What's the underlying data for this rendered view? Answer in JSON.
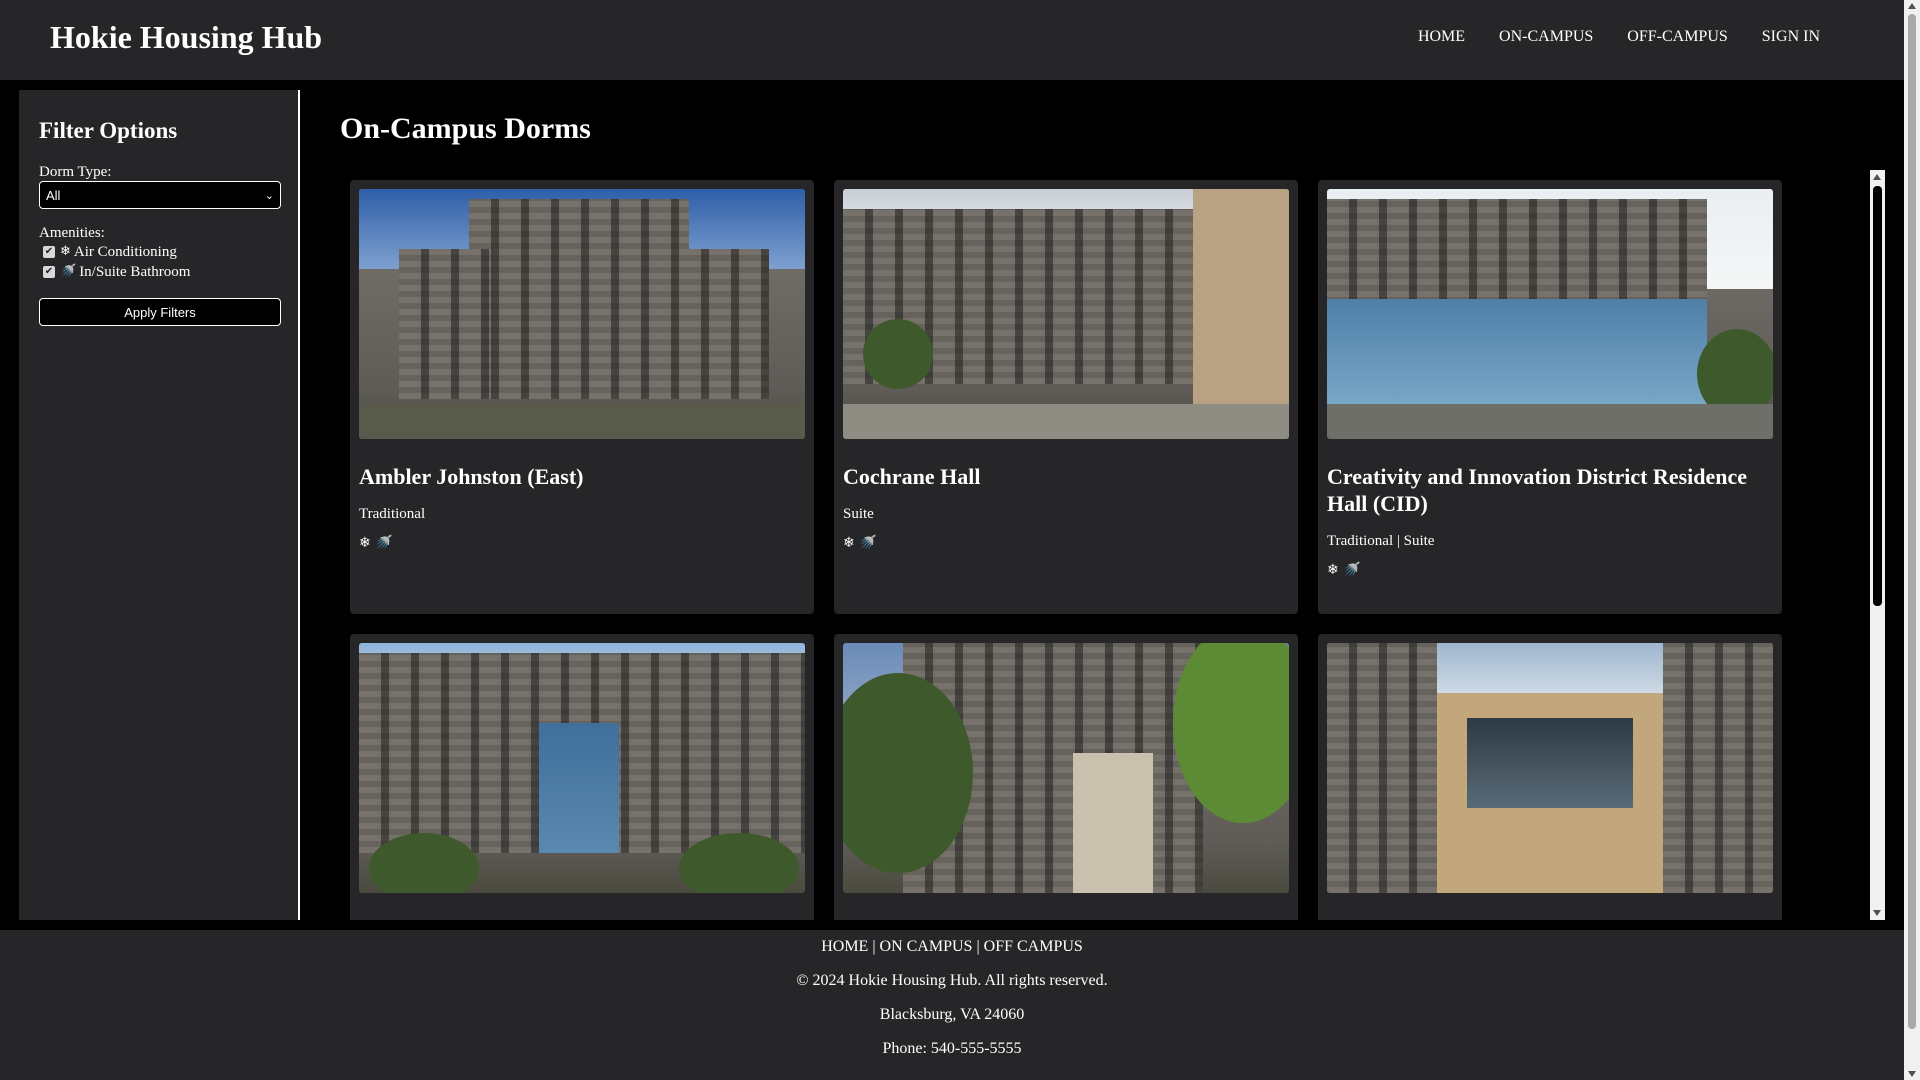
{
  "header": {
    "brand": "Hokie Housing Hub",
    "nav": [
      "HOME",
      "ON-CAMPUS",
      "OFF-CAMPUS",
      "SIGN IN"
    ]
  },
  "sidebar": {
    "title": "Filter Options",
    "dorm_type_label": "Dorm Type:",
    "dorm_type_value": "All",
    "amenities_label": "Amenities:",
    "amenities": [
      {
        "icon": "❄",
        "label": "Air Conditioning",
        "checked": true
      },
      {
        "icon": "🚿",
        "label": "In/Suite Bathroom",
        "checked": true
      }
    ],
    "apply_label": "Apply Filters"
  },
  "main": {
    "title": "On-Campus Dorms",
    "cards": [
      {
        "name": "Ambler Johnston (East)",
        "type": "Traditional",
        "icons": "❄ 🚿"
      },
      {
        "name": "Cochrane Hall",
        "type": "Suite",
        "icons": "❄ 🚿"
      },
      {
        "name": "Creativity and Innovation District Residence Hall (CID)",
        "type": "Traditional | Suite",
        "icons": "❄ 🚿"
      },
      {
        "name": "",
        "type": "",
        "icons": ""
      },
      {
        "name": "",
        "type": "",
        "icons": ""
      },
      {
        "name": "",
        "type": "",
        "icons": ""
      }
    ]
  },
  "footer": {
    "nav": [
      "HOME",
      "ON CAMPUS",
      "OFF CAMPUS"
    ],
    "separator": " | ",
    "copyright": "© 2024 Hokie Housing Hub. All rights reserved.",
    "address": "Blacksburg, VA 24060",
    "phone": "Phone: 540-555-5555"
  }
}
